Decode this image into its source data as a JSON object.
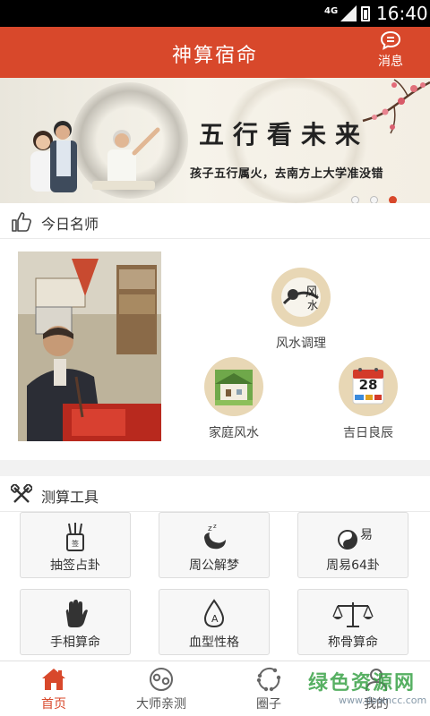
{
  "status_bar": {
    "network": "4G",
    "time": "16:40"
  },
  "header": {
    "title": "神算宿命",
    "message_label": "消息"
  },
  "banner": {
    "headline": "五行看未来",
    "subtitle": "孩子五行属火，去南方上大学准没错",
    "active_dot": 2,
    "dot_count": 3
  },
  "master_section": {
    "title": "今日名师",
    "features": [
      {
        "label": "风水调理",
        "icon": "feng-shui-icon"
      },
      {
        "label": "家庭风水",
        "icon": "house-icon"
      },
      {
        "label": "吉日良辰",
        "icon": "calendar-icon",
        "date": "28"
      }
    ]
  },
  "tools_section": {
    "title": "测算工具",
    "tools": [
      {
        "label": "抽签占卦",
        "icon": "fortune-sticks-icon"
      },
      {
        "label": "周公解梦",
        "icon": "moon-sleep-icon"
      },
      {
        "label": "周易64卦",
        "icon": "yin-yang-icon",
        "glyph": "易"
      },
      {
        "label": "手相算命",
        "icon": "palm-icon"
      },
      {
        "label": "血型性格",
        "icon": "blood-drop-icon",
        "glyph": "A"
      },
      {
        "label": "称骨算命",
        "icon": "scale-icon"
      }
    ]
  },
  "tab_bar": {
    "tabs": [
      {
        "label": "首页",
        "active": true
      },
      {
        "label": "大师亲测",
        "active": false
      },
      {
        "label": "圈子",
        "active": false
      },
      {
        "label": "我的",
        "active": false
      }
    ]
  },
  "watermark": {
    "text": "绿色资源网",
    "url": "www.downcc.com"
  },
  "colors": {
    "primary": "#d8482b",
    "background": "#f2f2f2"
  }
}
